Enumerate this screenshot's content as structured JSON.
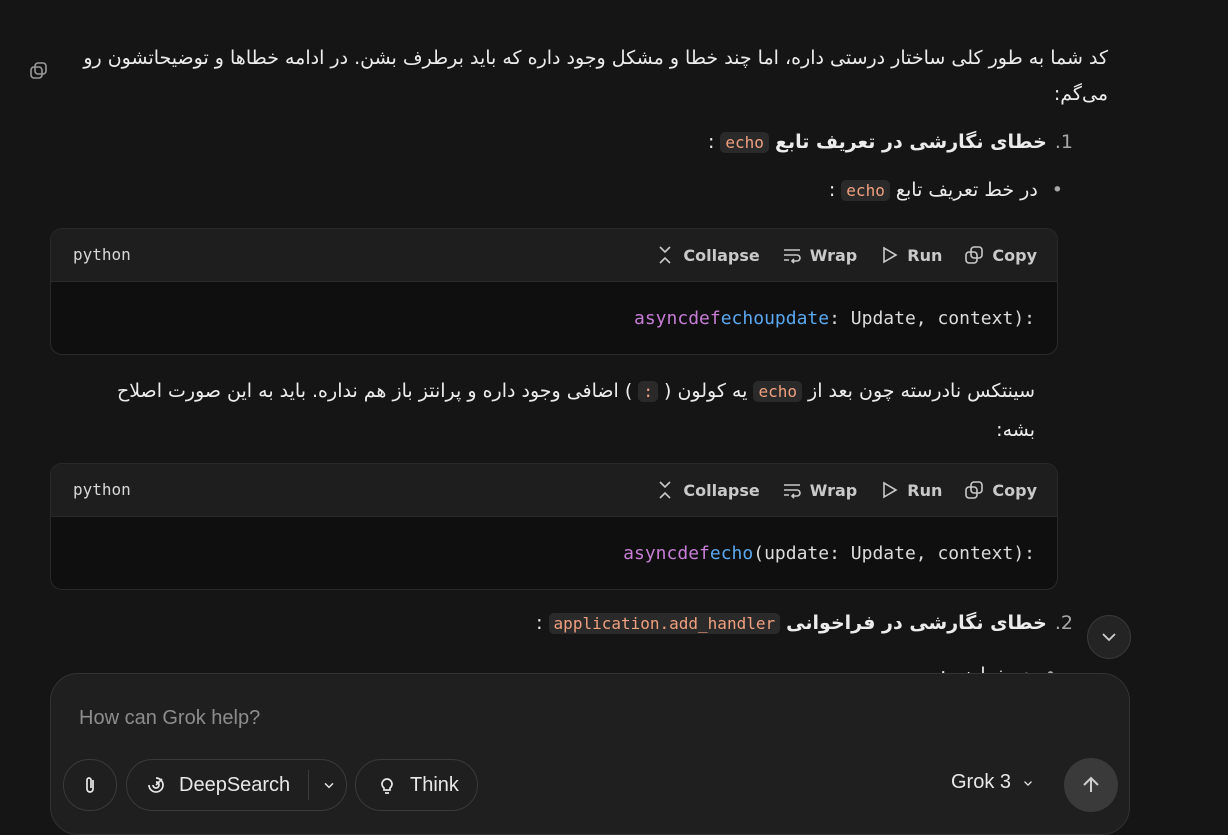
{
  "message": {
    "intro": "کد شما به طور کلی ساختار درستی داره، اما چند خطا و مشکل وجود داره که باید برطرف بشن. در ادامه خطاها و توضیحاتشون رو می‌گم:",
    "item1": {
      "number": "1.",
      "title": "خطای نگارشی در تعریف تابع",
      "code": "echo",
      "suffix": ":"
    },
    "bullet1": {
      "text": "در خط تعریف تابع",
      "code": "echo",
      "suffix": ":"
    },
    "explain": {
      "part1": "سینتکس نادرسته چون بعد از",
      "code1": "echo",
      "part2": "یه کولون (",
      "code2": ":",
      "part3": ") اضافی وجود داره و پرانتز باز هم نداره. باید به این صورت اصلاح بشه:"
    },
    "item2": {
      "number": "2.",
      "title": "خطای نگارشی در فراخوانی",
      "code": "application.add_handler",
      "suffix": ":"
    },
    "bullet2_partial": "در خط زیر:"
  },
  "codeblocks": [
    {
      "lang": "python",
      "actions": {
        "collapse": "Collapse",
        "wrap": "Wrap",
        "run": "Run",
        "copy": "Copy"
      },
      "tokens": {
        "k1": "async",
        "k2": "def",
        "f1": "echo",
        "f2": "update",
        "rest": ": Update, context):"
      }
    },
    {
      "lang": "python",
      "actions": {
        "collapse": "Collapse",
        "wrap": "Wrap",
        "run": "Run",
        "copy": "Copy"
      },
      "tokens": {
        "k1": "async",
        "k2": "def",
        "f1": "echo",
        "rest": "(update: Update, context):"
      }
    }
  ],
  "composer": {
    "placeholder": "How can Grok help?",
    "deepsearch": "DeepSearch",
    "think": "Think",
    "model": "Grok 3"
  }
}
